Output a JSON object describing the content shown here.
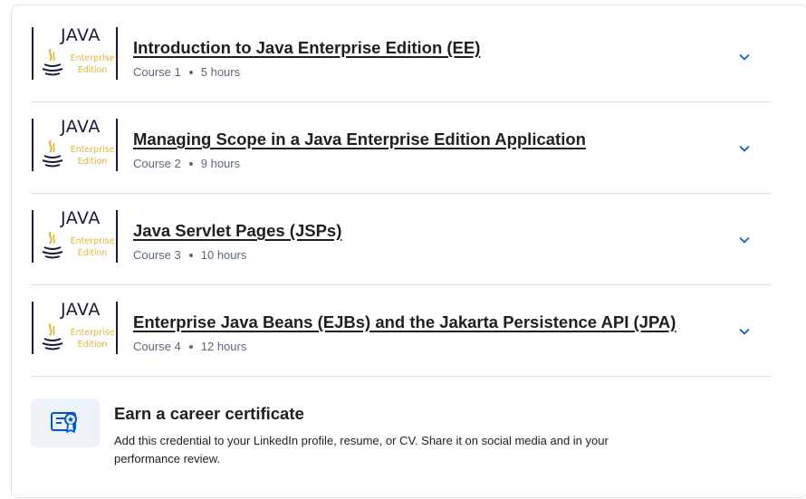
{
  "thumbnail": {
    "word_java": "JAVA",
    "word_enterprise": "Enterprise",
    "word_edition": "Edition"
  },
  "courses": [
    {
      "title": "Introduction to Java Enterprise Edition (EE)",
      "course_label": "Course 1",
      "duration": "5 hours"
    },
    {
      "title": "Managing Scope in a Java Enterprise Edition Application",
      "course_label": "Course 2",
      "duration": "9 hours"
    },
    {
      "title": "Java Servlet Pages (JSPs)",
      "course_label": "Course 3",
      "duration": "10 hours"
    },
    {
      "title": "Enterprise Java Beans (EJBs) and the Jakarta Persistence API (JPA)",
      "course_label": "Course 4",
      "duration": "12 hours"
    }
  ],
  "certificate": {
    "title": "Earn a career certificate",
    "description": "Add this credential to your LinkedIn profile, resume, or CV. Share it on social media and in your performance review.",
    "icon": "certificate-icon"
  },
  "colors": {
    "accent": "#0056d2",
    "muted_text": "#5b6780",
    "java_gold": "#e2b43b",
    "java_navy": "#1a1a3a"
  }
}
